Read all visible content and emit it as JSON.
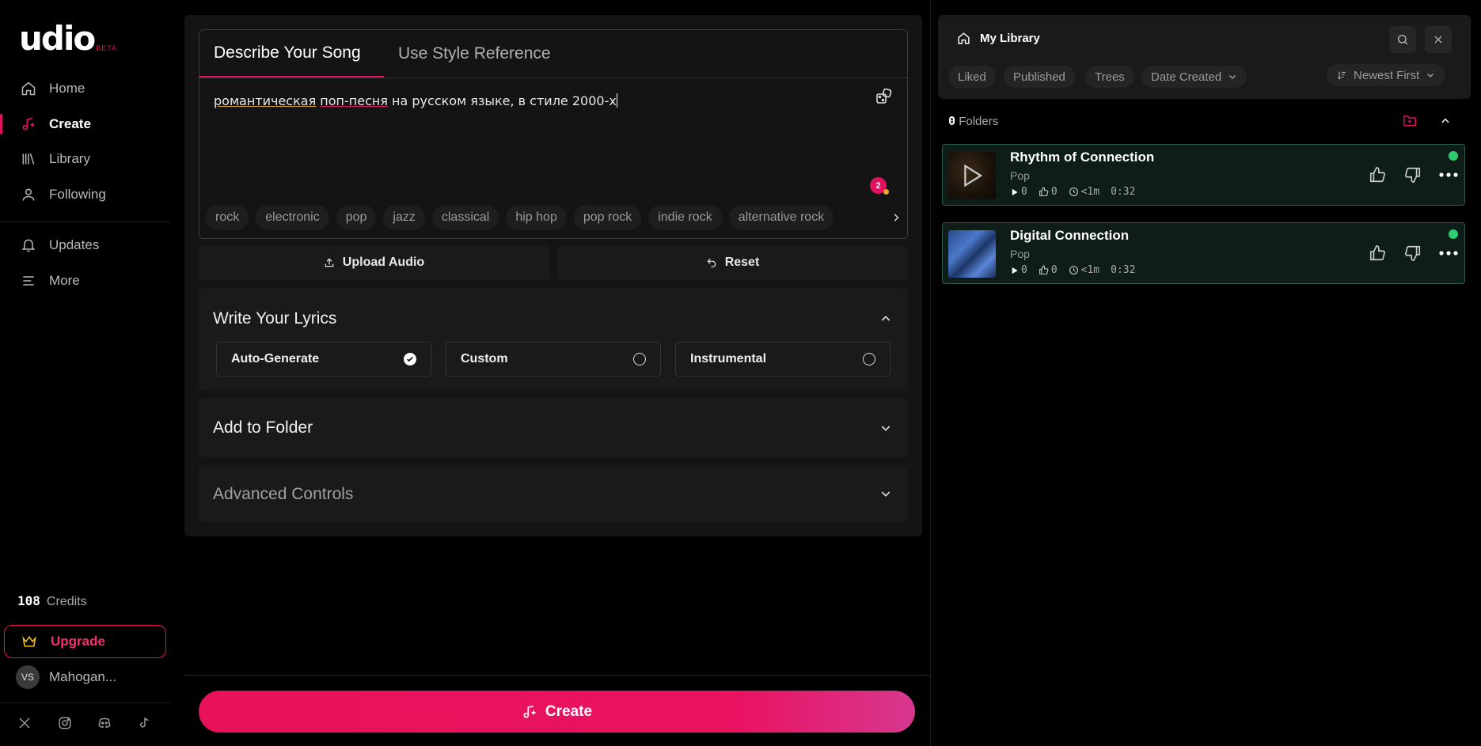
{
  "brand": {
    "name": "udio",
    "tag": "BETA"
  },
  "nav": {
    "home": "Home",
    "create": "Create",
    "library": "Library",
    "following": "Following",
    "updates": "Updates",
    "more": "More"
  },
  "account": {
    "credits_count": "108",
    "credits_label": "Credits",
    "upgrade": "Upgrade",
    "avatar_initials": "VS",
    "user_name": "Mahogan..."
  },
  "create": {
    "tabs": [
      "Describe Your Song",
      "Use Style Reference"
    ],
    "prompt_words": [
      "романтическая",
      " ",
      "поп-песня",
      " на русском языке, в стиле 2000-х"
    ],
    "notification_count": "2",
    "tags": [
      "rock",
      "electronic",
      "pop",
      "jazz",
      "classical",
      "hip hop",
      "pop rock",
      "indie rock",
      "alternative rock"
    ],
    "upload_audio": "Upload Audio",
    "reset": "Reset",
    "lyrics": {
      "title": "Write Your Lyrics",
      "options": [
        "Auto-Generate",
        "Custom",
        "Instrumental"
      ],
      "selected": "Auto-Generate"
    },
    "add_folder": "Add to Folder",
    "advanced": "Advanced Controls",
    "create_button": "Create"
  },
  "library": {
    "title": "My Library",
    "filters": [
      "Liked",
      "Published",
      "Trees",
      "Date Created"
    ],
    "sort": "Newest First",
    "folders_count": "0",
    "folders_label": "Folders",
    "songs": [
      {
        "title": "Rhythm of Connection",
        "genre": "Pop",
        "plays": "0",
        "likes": "0",
        "age": "<1m",
        "duration": "0:32"
      },
      {
        "title": "Digital Connection",
        "genre": "Pop",
        "plays": "0",
        "likes": "0",
        "age": "<1m",
        "duration": "0:32"
      }
    ]
  },
  "colors": {
    "accent": "#e0115f",
    "status_ready": "#2ecc71",
    "song_border": "#2d5a48"
  }
}
